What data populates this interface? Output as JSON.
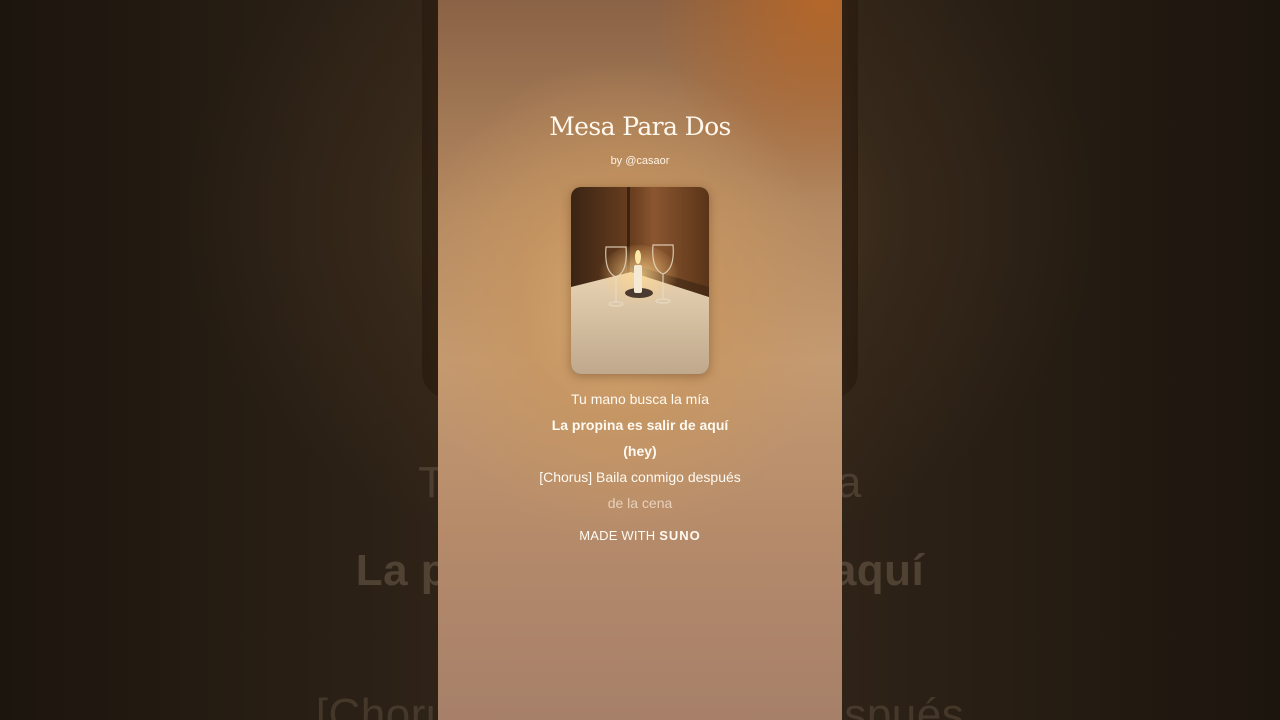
{
  "song": {
    "title": "Mesa Para Dos",
    "byline": "by @casaor"
  },
  "lyrics": [
    {
      "text": "Tu mano busca la mía",
      "style": "normal"
    },
    {
      "text": "La propina es salir de aquí",
      "style": "bold"
    },
    {
      "text": "(hey)",
      "style": "bold"
    },
    {
      "text": "[Chorus] Baila conmigo después",
      "style": "normal"
    },
    {
      "text": "de la cena",
      "style": "faded"
    }
  ],
  "background_lyrics": {
    "line1": "Tu mano busca la mía",
    "line2": "La propina es salir de aquí",
    "line3": "[Chorus] Baila conmigo después"
  },
  "footer": {
    "prefix": "MADE WITH",
    "brand": "SUNO"
  },
  "cover_art": {
    "icon": "candlelit-table-image"
  },
  "colors": {
    "accent_warm": "#c49a72",
    "text": "#fffaf2"
  }
}
